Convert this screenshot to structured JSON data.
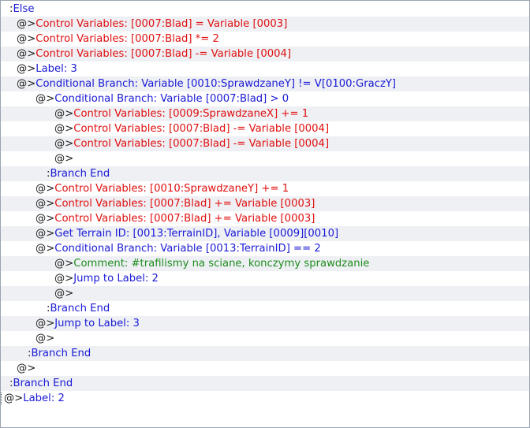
{
  "editor": {
    "lines": [
      {
        "prefix": ": ",
        "text": "Else",
        "color": "#1a1ad6"
      },
      {
        "prefix": "@>",
        "text": "Control Variables: [0007:Blad] = Variable [0003]",
        "color": "#e01010"
      },
      {
        "prefix": "@>",
        "text": "Control Variables: [0007:Blad] *= 2",
        "color": "#e01010"
      },
      {
        "prefix": "@>",
        "text": "Control Variables: [0007:Blad] -= Variable [0004]",
        "color": "#e01010"
      },
      {
        "prefix": "@>",
        "text": "Label: 3",
        "color": "#1a1ad6"
      },
      {
        "prefix": "@>",
        "text": "Conditional Branch: Variable [0010:SprawdzaneY] != V[0100:GraczY]",
        "color": "#1a1ad6"
      },
      {
        "prefix": "@>",
        "text": "Conditional Branch: Variable [0007:Blad] > 0",
        "color": "#1a1ad6"
      },
      {
        "prefix": "@>",
        "text": "Control Variables: [0009:SprawdzaneX] += 1",
        "color": "#e01010"
      },
      {
        "prefix": "@>",
        "text": "Control Variables: [0007:Blad] -= Variable [0004]",
        "color": "#e01010"
      },
      {
        "prefix": "@>",
        "text": "Control Variables: [0007:Blad] -= Variable [0004]",
        "color": "#e01010"
      },
      {
        "prefix": "@>",
        "text": "",
        "color": "#1a1ad6"
      },
      {
        "prefix": ": ",
        "text": "Branch End",
        "color": "#1a1ad6"
      },
      {
        "prefix": "@>",
        "text": "Control Variables: [0010:SprawdzaneY] += 1",
        "color": "#e01010"
      },
      {
        "prefix": "@>",
        "text": "Control Variables: [0007:Blad] += Variable [0003]",
        "color": "#e01010"
      },
      {
        "prefix": "@>",
        "text": "Control Variables: [0007:Blad] += Variable [0003]",
        "color": "#e01010"
      },
      {
        "prefix": "@>",
        "text": "Get Terrain ID: [0013:TerrainID], Variable [0009][0010]",
        "color": "#1a1ad6"
      },
      {
        "prefix": "@>",
        "text": "Conditional Branch: Variable [0013:TerrainID] == 2",
        "color": "#1a1ad6"
      },
      {
        "prefix": "@>",
        "text": "Comment: #trafilismy na sciane, konczymy sprawdzanie",
        "color": "#1e8c1e"
      },
      {
        "prefix": "@>",
        "text": "Jump to Label: 2",
        "color": "#1a1ad6"
      },
      {
        "prefix": "@>",
        "text": "",
        "color": "#1a1ad6"
      },
      {
        "prefix": ": ",
        "text": "Branch End",
        "color": "#1a1ad6"
      },
      {
        "prefix": "@>",
        "text": "Jump to Label: 3",
        "color": "#1a1ad6"
      },
      {
        "prefix": "@>",
        "text": "",
        "color": "#1a1ad6"
      },
      {
        "prefix": ": ",
        "text": "Branch End",
        "color": "#1a1ad6"
      },
      {
        "prefix": "@>",
        "text": "",
        "color": "#1a1ad6"
      },
      {
        "prefix": ": ",
        "text": "Branch End",
        "color": "#1a1ad6"
      },
      {
        "prefix": "@>",
        "text": "Label: 2",
        "color": "#1a1ad6"
      }
    ]
  }
}
